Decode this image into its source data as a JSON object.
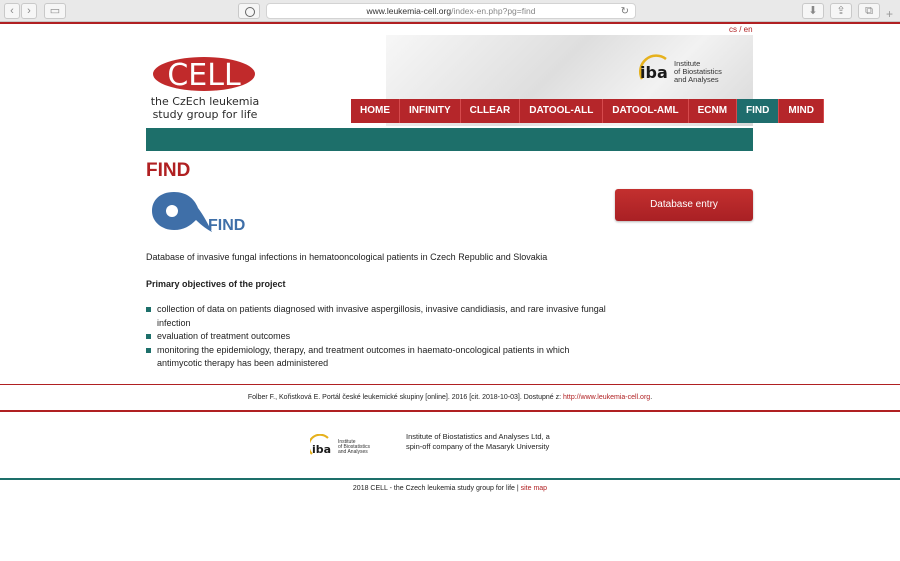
{
  "browser": {
    "url_domain": "www.leukemia-cell.org",
    "url_path": "/index-en.php?pg=find"
  },
  "lang": {
    "cs": "cs",
    "sep": " / ",
    "en": "en"
  },
  "header": {
    "logo_text": "CELL",
    "logo_sub_1": "the CzEch leukemia",
    "logo_sub_2": "study group for life",
    "iba_mark": "iba",
    "iba_line1": "Institute",
    "iba_line2": "of Biostatistics",
    "iba_line3": "and Analyses"
  },
  "menu": [
    {
      "label": "HOME"
    },
    {
      "label": "INFINITY"
    },
    {
      "label": "CLLEAR"
    },
    {
      "label": "DATOOL-ALL"
    },
    {
      "label": "DATOOL-AML"
    },
    {
      "label": "ECNM"
    },
    {
      "label": "FIND",
      "active": true
    },
    {
      "label": "MIND"
    }
  ],
  "main": {
    "title": "FIND",
    "find_logo_text": "FIND",
    "db_button": "Database entry",
    "intro": "Database of invasive fungal infections in hematooncological patients in Czech Republic and Slovakia",
    "objectives_title": "Primary objectives of the project",
    "objectives": [
      "collection of data on patients diagnosed with invasive aspergillosis, invasive candidiasis, and rare invasive fungal infection",
      "evaluation of treatment outcomes",
      "monitoring the epidemiology, therapy, and treatment outcomes in haemato-oncological patients in which antimycotic therapy has been administered"
    ]
  },
  "citation": {
    "text": "Folber F., Kořistková E. Portál české leukemické skupiny [online]. 2016 [cit. 2018-10-03]. Dostupné z: ",
    "link": "http://www.leukemia-cell.org",
    "end": "."
  },
  "footer": {
    "iba_mark": "iba",
    "iba_line1": "Institute",
    "iba_line2": "of Biostatistics",
    "iba_line3": "and Analyses",
    "desc": "Institute of Biostatistics and Analyses Ltd, a spin-off company of the Masaryk University",
    "bottom_text": "2018 CELL - the Czech leukemia study group for life | ",
    "sitemap": "site map"
  },
  "colors": {
    "brand_red": "#b02022",
    "teal": "#1d6f6a"
  }
}
